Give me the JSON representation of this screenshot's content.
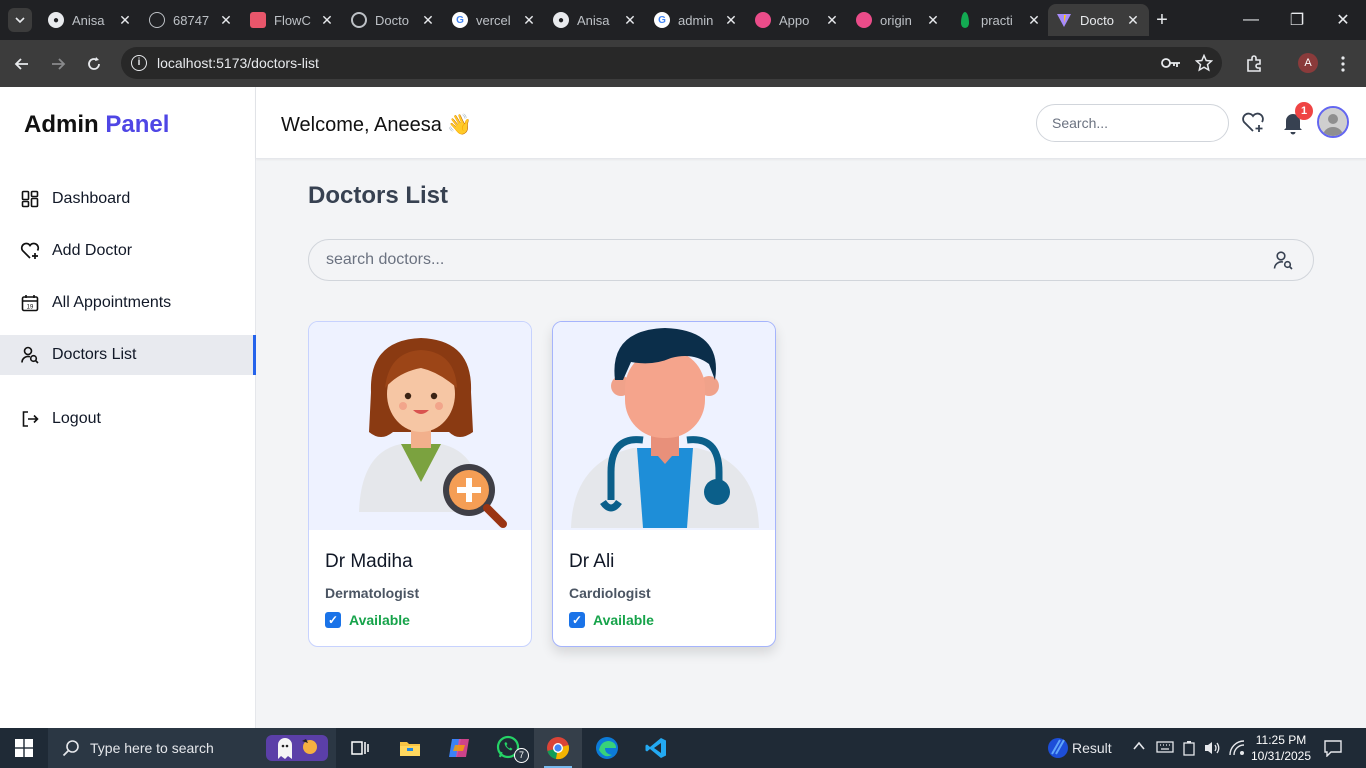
{
  "browser": {
    "tabs": [
      {
        "title": "Anisa",
        "icon": "github-icon"
      },
      {
        "title": "68747",
        "icon": "globe-icon"
      },
      {
        "title": "FlowC",
        "icon": "flowcv-icon"
      },
      {
        "title": "Docto",
        "icon": "chatgpt-icon"
      },
      {
        "title": "vercel",
        "icon": "google-icon"
      },
      {
        "title": "Anisa",
        "icon": "github-icon"
      },
      {
        "title": "admin",
        "icon": "google-icon"
      },
      {
        "title": "Appo",
        "icon": "dribbble-icon"
      },
      {
        "title": "origin",
        "icon": "dribbble-icon"
      },
      {
        "title": "practi",
        "icon": "mongodb-icon"
      },
      {
        "title": "Docto",
        "icon": "vite-icon",
        "active": true
      }
    ],
    "url": "localhost:5173/doctors-list",
    "profile_initial": "A"
  },
  "sidebar": {
    "brand_main": "Admin",
    "brand_accent": "Panel",
    "items": [
      {
        "label": "Dashboard",
        "icon": "dashboard-icon"
      },
      {
        "label": "Add Doctor",
        "icon": "heart-plus-icon"
      },
      {
        "label": "All Appointments",
        "icon": "calendar-icon"
      },
      {
        "label": "Doctors List",
        "icon": "user-search-icon",
        "active": true
      }
    ],
    "logout_label": "Logout"
  },
  "header": {
    "welcome": "Welcome, Aneesa 👋",
    "search_placeholder": "Search...",
    "notification_count": "1"
  },
  "main": {
    "title": "Doctors List",
    "search_placeholder": "search doctors...",
    "doctors": [
      {
        "name": "Dr Madiha",
        "speciality": "Dermatologist",
        "status": "Available",
        "available": true
      },
      {
        "name": "Dr Ali",
        "speciality": "Cardiologist",
        "status": "Available",
        "available": true
      }
    ]
  },
  "taskbar": {
    "search_placeholder": "Type here to search",
    "whatsapp_badge": "7",
    "weather_label": "Result",
    "time": "11:25 PM",
    "date": "10/31/2025"
  },
  "colors": {
    "accent": "#4f46e5",
    "active_border": "#2563eb",
    "available": "#16a34a",
    "badge": "#ef4444"
  }
}
